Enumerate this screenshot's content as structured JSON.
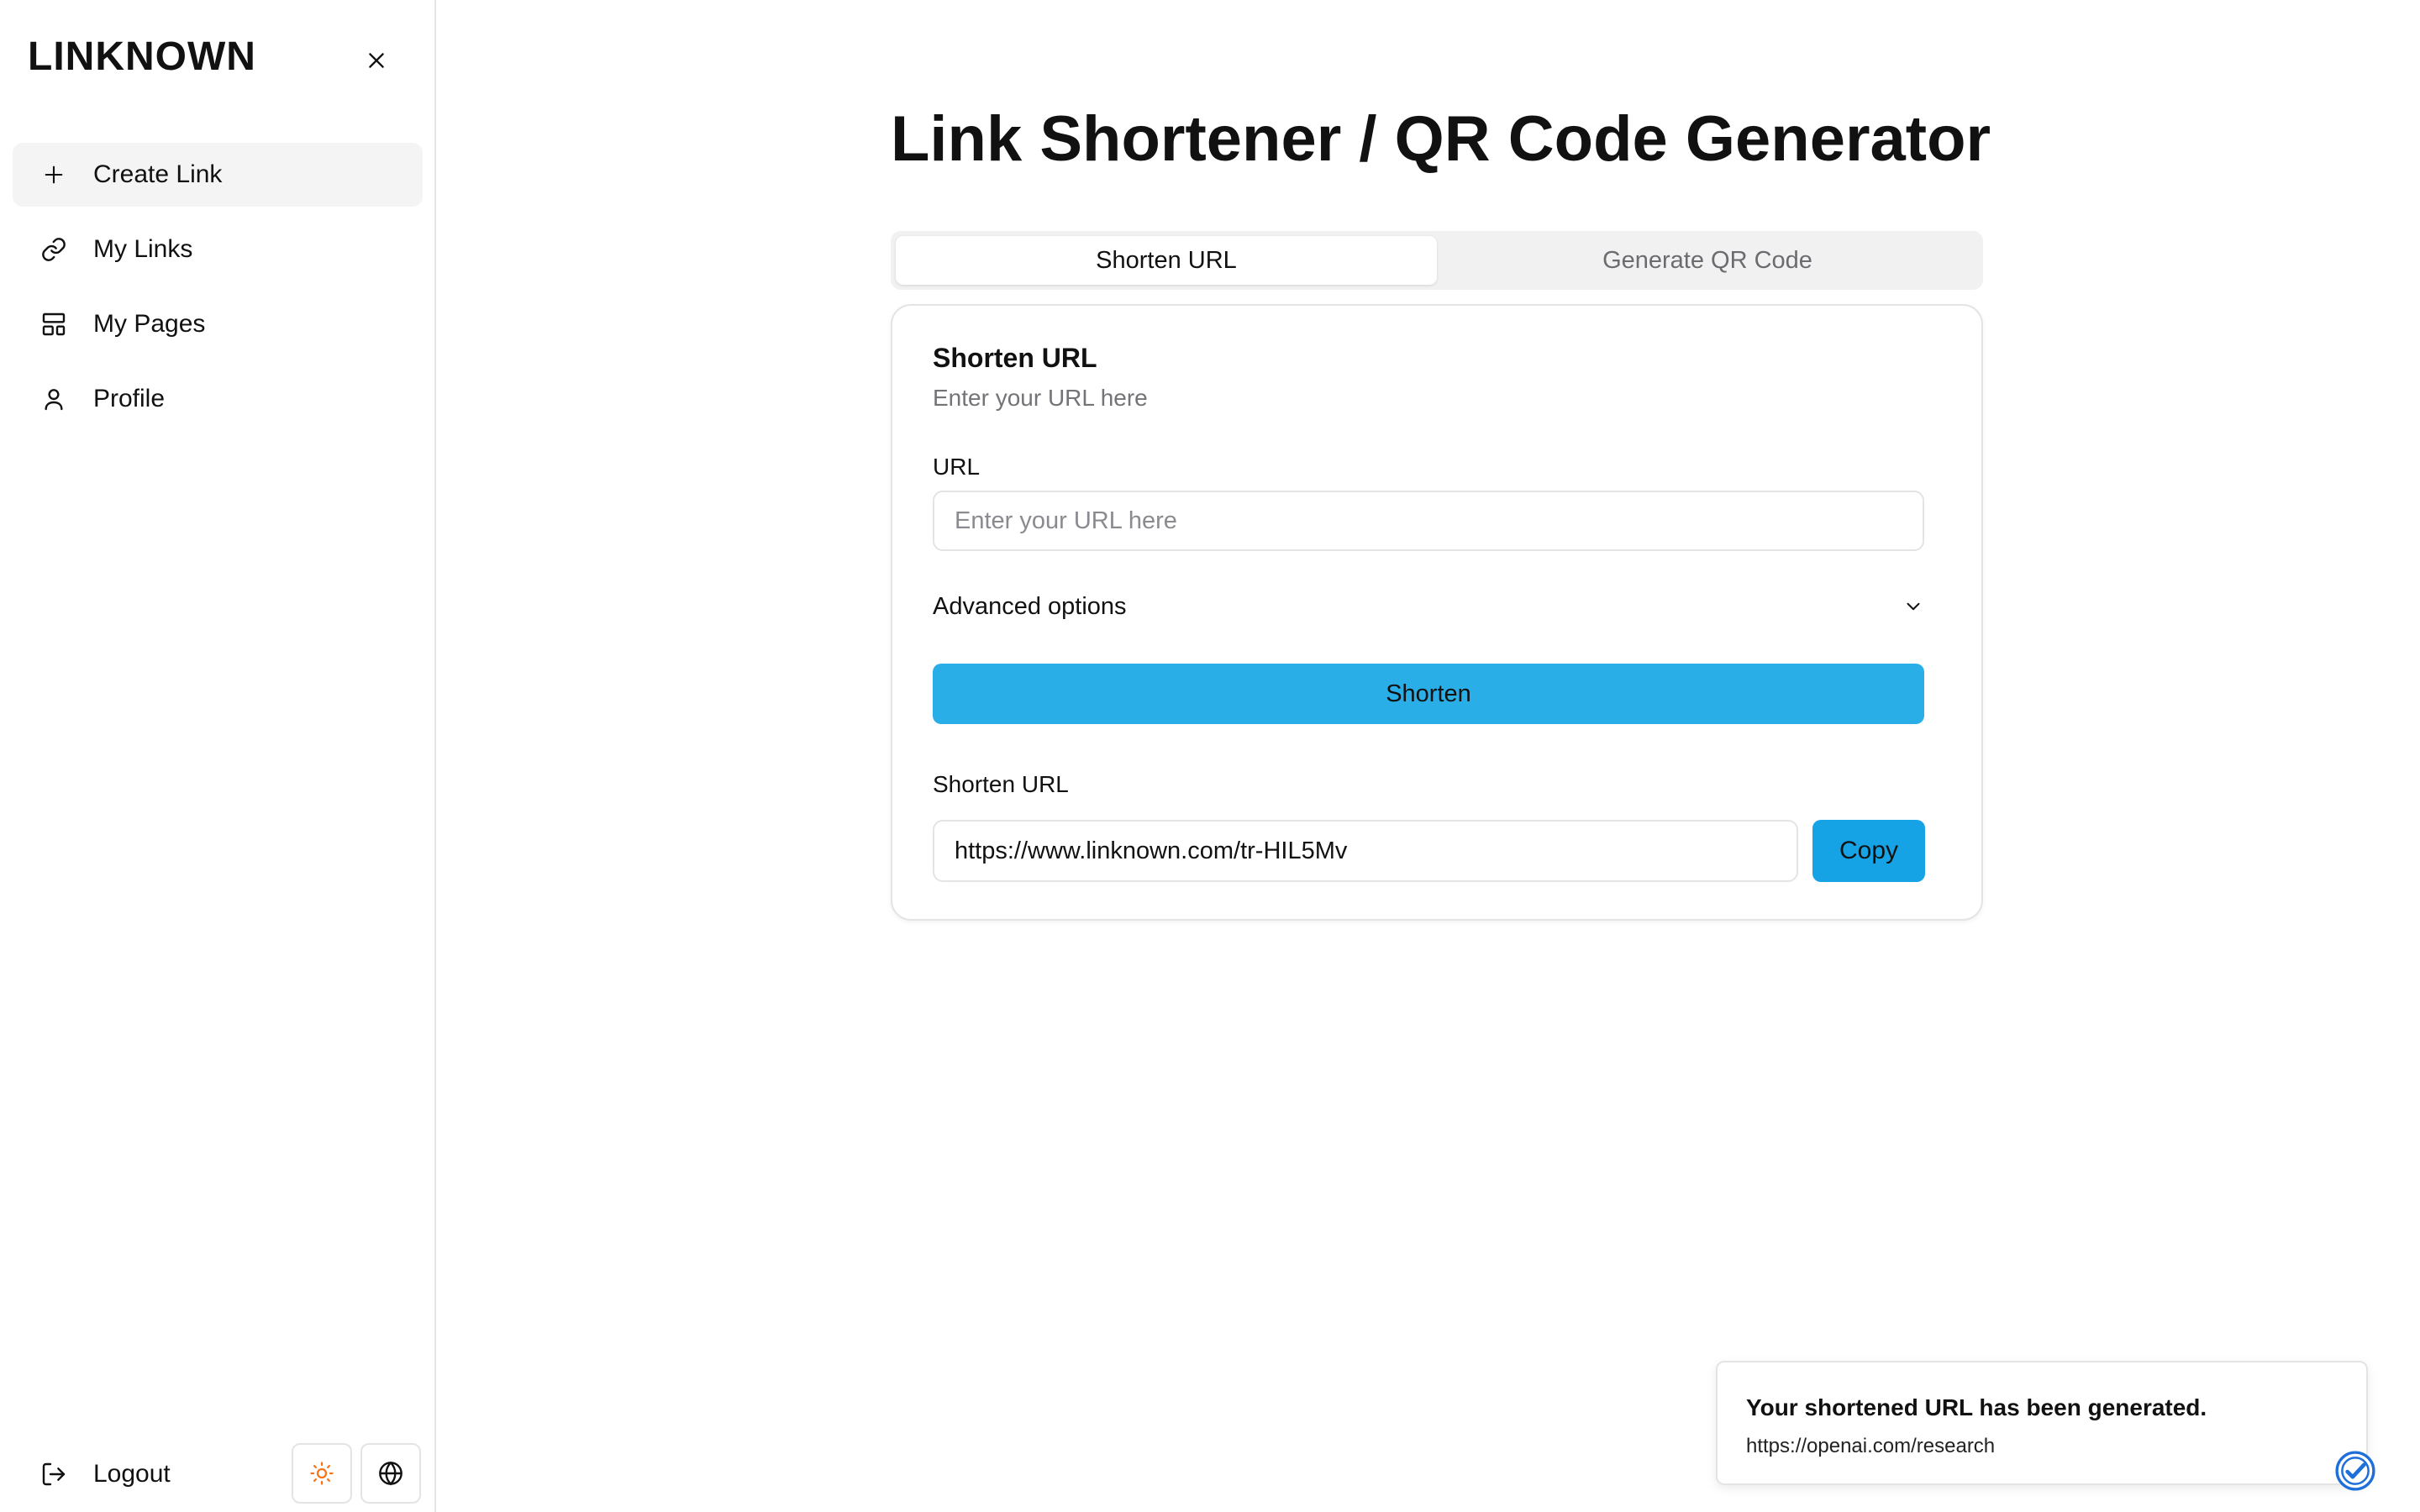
{
  "brand": {
    "name": "LINKNOWN"
  },
  "sidebar": {
    "close_icon": "close-icon",
    "items": [
      {
        "label": "Create Link",
        "icon": "plus-icon",
        "active": true
      },
      {
        "label": "My Links",
        "icon": "link-icon",
        "active": false
      },
      {
        "label": "My Pages",
        "icon": "layout-icon",
        "active": false
      },
      {
        "label": "Profile",
        "icon": "user-icon",
        "active": false
      }
    ],
    "footer": {
      "logout_label": "Logout",
      "theme_icon": "sun-icon",
      "language_icon": "globe-icon"
    }
  },
  "main": {
    "title": "Link Shortener / QR Code Generator",
    "tabs": [
      {
        "label": "Shorten URL",
        "active": true
      },
      {
        "label": "Generate QR Code",
        "active": false
      }
    ],
    "card": {
      "title": "Shorten URL",
      "description": "Enter your URL here",
      "url_label": "URL",
      "url_placeholder": "Enter your URL here",
      "url_value": "",
      "advanced_label": "Advanced options",
      "shorten_button": "Shorten",
      "result_label": "Shorten URL",
      "result_value": "https://www.linknown.com/tr-HIL5Mv",
      "copy_button": "Copy"
    }
  },
  "toast": {
    "title": "Your shortened URL has been generated.",
    "description": "https://openai.com/research"
  },
  "colors": {
    "accent": "#2aaee8",
    "copy": "#16a3e6",
    "sun": "#f97316",
    "badge": "#1e6fd9"
  }
}
